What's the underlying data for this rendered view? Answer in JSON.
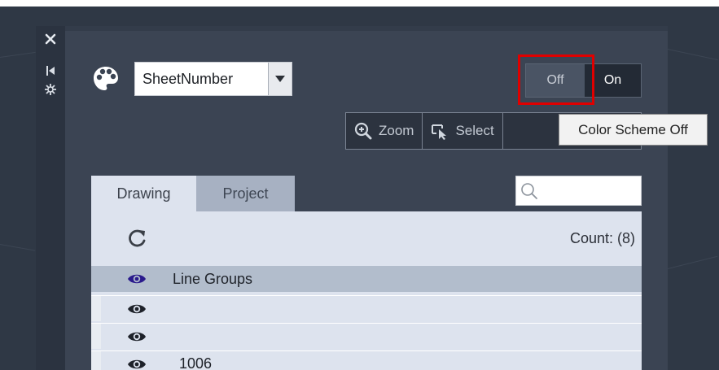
{
  "side_strip": {
    "icons": [
      "close-icon",
      "pin-icon",
      "settings-icon"
    ]
  },
  "header": {
    "palette_icon": "palette-icon",
    "combo_value": "SheetNumber",
    "toggle": {
      "off_label": "Off",
      "on_label": "On",
      "selected": "Off"
    },
    "highlight_color": "#e00000"
  },
  "toolbar": {
    "zoom_label": "Zoom",
    "select_label": "Select"
  },
  "tooltip": {
    "text": "Color Scheme Off"
  },
  "tabs": [
    {
      "label": "Drawing",
      "active": true
    },
    {
      "label": "Project",
      "active": false
    }
  ],
  "search": {
    "placeholder": ""
  },
  "list": {
    "count_label": "Count: (8)",
    "rows": [
      {
        "label": "Line Groups",
        "eye_color": "#2a1a8c"
      },
      {
        "label": "",
        "eye_color": "#1e222a"
      },
      {
        "label": "",
        "eye_color": "#1e222a"
      },
      {
        "label": "1006",
        "eye_color": "#1e222a"
      }
    ]
  }
}
